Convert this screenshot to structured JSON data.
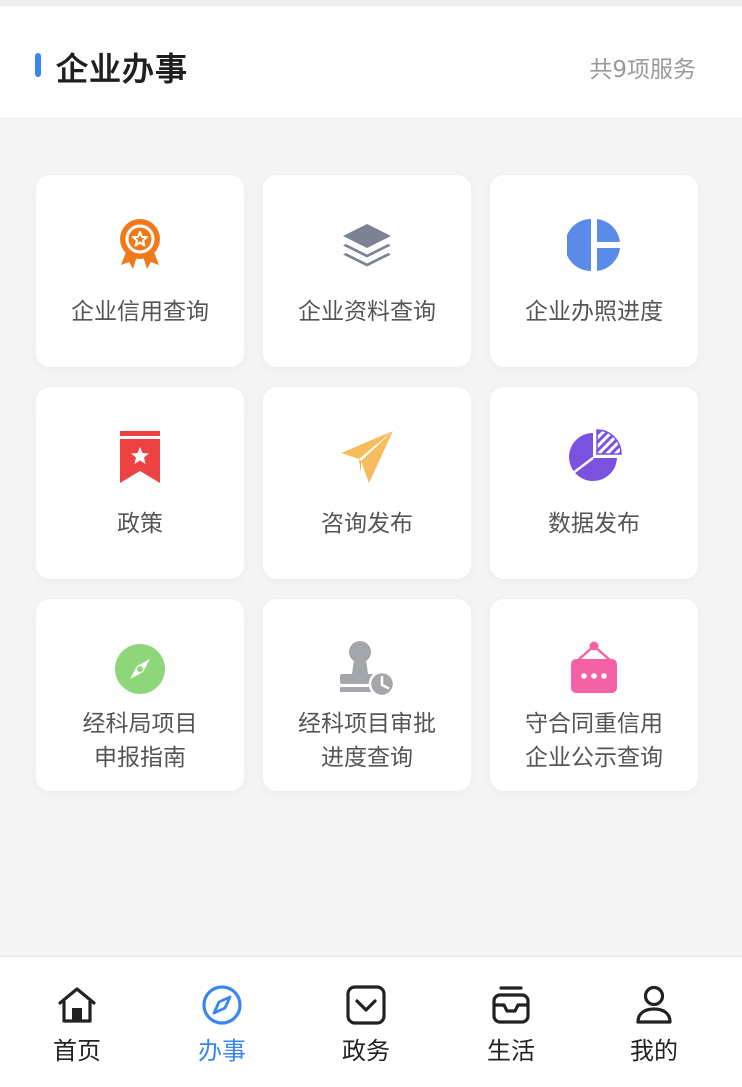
{
  "header": {
    "title": "企业办事",
    "count": "共9项服务",
    "accent": "#3a86f0"
  },
  "services": [
    {
      "label": "企业信用查询",
      "icon": "award-icon",
      "color": "#f07a1a"
    },
    {
      "label": "企业资料查询",
      "icon": "layers-icon",
      "color": "#7c8294"
    },
    {
      "label": "企业办照进度",
      "icon": "pie-split-icon",
      "color": "#5b8be8"
    },
    {
      "label": "政策",
      "icon": "bookmark-star-icon",
      "color": "#ee4142"
    },
    {
      "label": "咨询发布",
      "icon": "paper-plane-icon",
      "color": "#f5bd5e"
    },
    {
      "label": "数据发布",
      "icon": "pie-chart-icon",
      "color": "#7b52e0"
    },
    {
      "label_line1": "经科局项目",
      "label_line2": "申报指南",
      "icon": "compass-icon",
      "color": "#8dd67a"
    },
    {
      "label_line1": "经科项目审批",
      "label_line2": "进度查询",
      "icon": "stamp-clock-icon",
      "color": "#a4a6ab"
    },
    {
      "label_line1": "守合同重信用",
      "label_line2": "企业公示查询",
      "icon": "hanging-sign-icon",
      "color": "#f461a5"
    }
  ],
  "tabs": [
    {
      "label": "首页",
      "icon": "home-icon"
    },
    {
      "label": "办事",
      "icon": "compass-icon",
      "active": true
    },
    {
      "label": "政务",
      "icon": "inbox-check-icon"
    },
    {
      "label": "生活",
      "icon": "tray-icon"
    },
    {
      "label": "我的",
      "icon": "user-icon"
    }
  ]
}
